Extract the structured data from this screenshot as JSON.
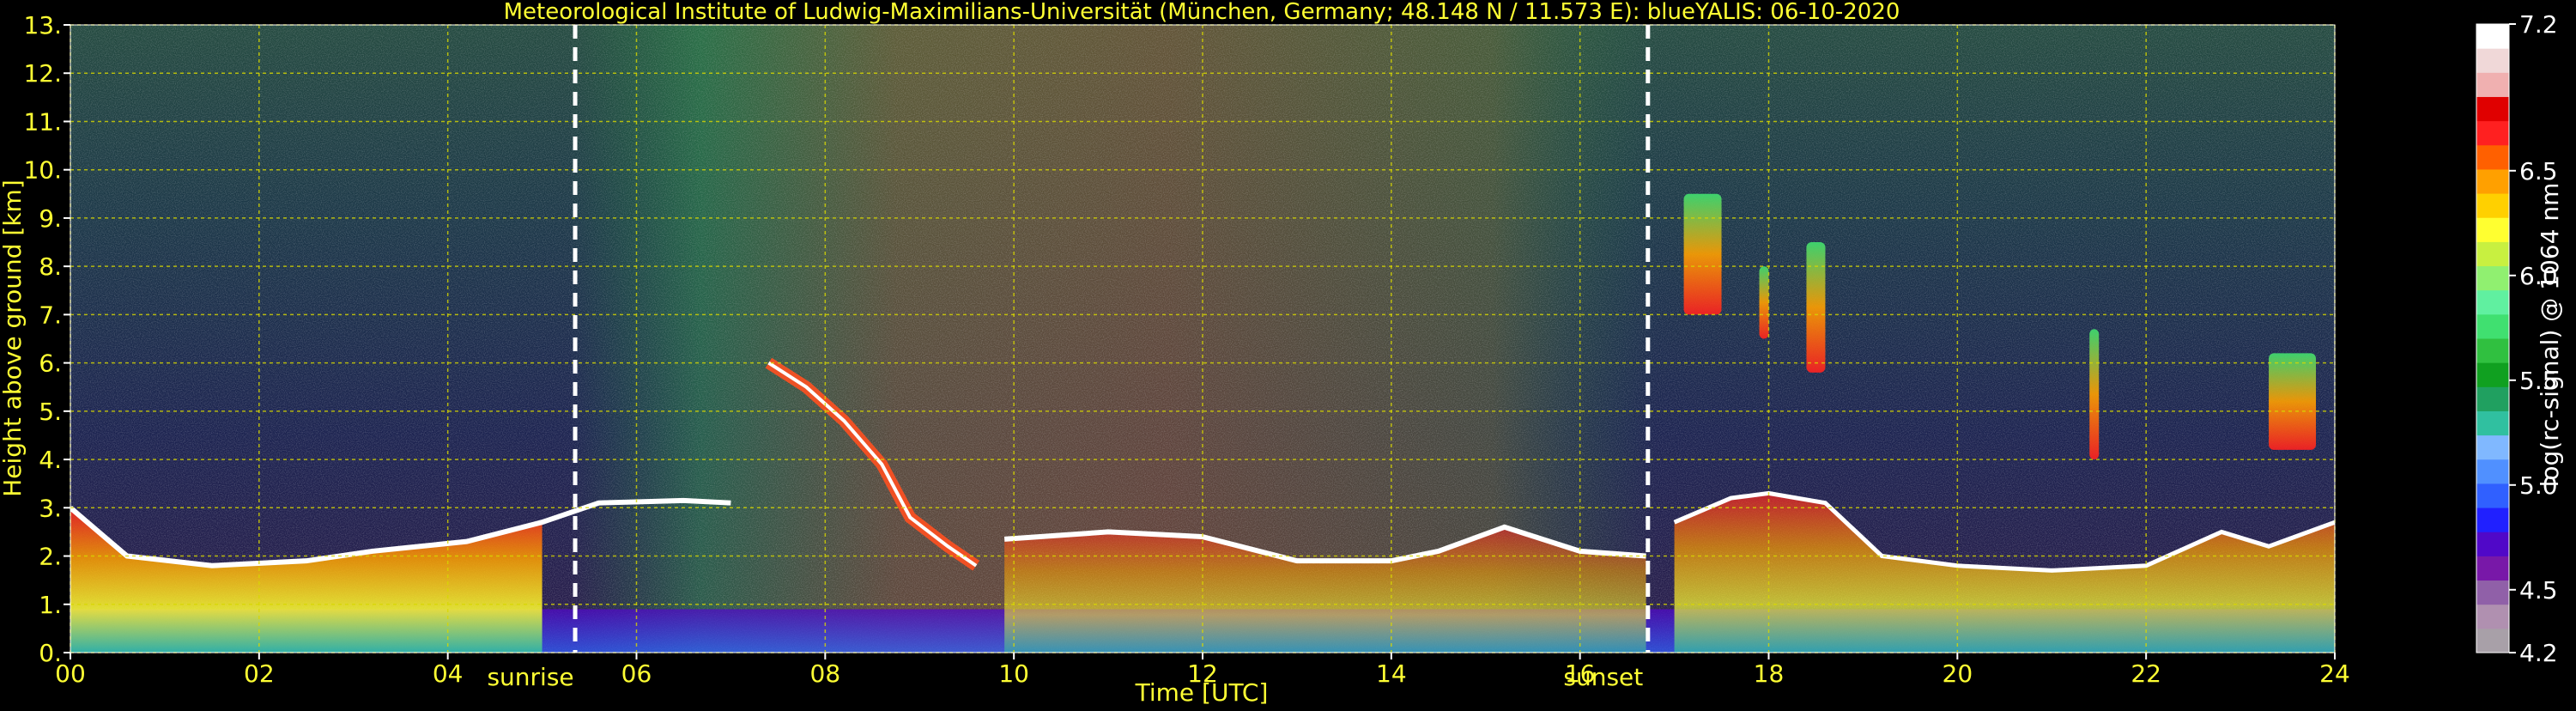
{
  "chart_data": {
    "type": "heatmap",
    "title": "Meteorological Institute of Ludwig-Maximilians-Universität (München, Germany; 48.148 N / 11.573 E):     blueYALIS: 06-10-2020",
    "xlabel": "Time [UTC]",
    "ylabel": "Height above ground [km]",
    "xlim": [
      0,
      24
    ],
    "ylim": [
      0,
      13
    ],
    "x_ticks": [
      "00",
      "02",
      "04",
      "06",
      "08",
      "10",
      "12",
      "14",
      "16",
      "18",
      "20",
      "22",
      "24"
    ],
    "y_ticks": [
      "0.",
      "1.",
      "2.",
      "3.",
      "4.",
      "5.",
      "6.",
      "7.",
      "8.",
      "9.",
      "10.",
      "11.",
      "12.",
      "13."
    ],
    "grid": true,
    "grid_color": "#d8d800",
    "text_color": "#ffff33",
    "events": [
      {
        "label": "sunrise",
        "time": 5.35
      },
      {
        "label": "sunset",
        "time": 16.72
      }
    ],
    "colorbar": {
      "label": "log(rc-signal) @ 1064 nm",
      "min": 4.2,
      "max": 7.2,
      "tick_labels": [
        "7.2",
        "6.5",
        "6.0",
        "5.5",
        "5.0",
        "4.5",
        "4.2"
      ],
      "tick_values": [
        7.2,
        6.5,
        6.0,
        5.5,
        5.0,
        4.5,
        4.2
      ],
      "colors": [
        "#a8a0a8",
        "#b090b0",
        "#9060a8",
        "#7818a8",
        "#5008c8",
        "#2020ff",
        "#3060ff",
        "#5090ff",
        "#80b8ff",
        "#30c0a0",
        "#20a060",
        "#10a020",
        "#30c040",
        "#40e070",
        "#60f0a0",
        "#90f070",
        "#c8f040",
        "#ffff30",
        "#ffd000",
        "#ffa000",
        "#ff6000",
        "#ff2020",
        "#e00000",
        "#f0b0b0",
        "#f0d8d8",
        "#ffffff"
      ]
    },
    "features": {
      "boundary_layer_top": [
        [
          0,
          3.0
        ],
        [
          0.6,
          2.0
        ],
        [
          1.5,
          1.8
        ],
        [
          2.5,
          1.9
        ],
        [
          3.2,
          2.1
        ],
        [
          4.2,
          2.3
        ],
        [
          5.0,
          2.7
        ],
        [
          5.6,
          3.1
        ],
        [
          6.5,
          3.15
        ],
        [
          7.0,
          3.1
        ]
      ],
      "descending_layer": [
        [
          7.4,
          6.0
        ],
        [
          7.8,
          5.5
        ],
        [
          8.2,
          4.8
        ],
        [
          8.6,
          3.9
        ],
        [
          8.9,
          2.8
        ],
        [
          9.3,
          2.2
        ],
        [
          9.6,
          1.8
        ]
      ],
      "afternoon_layer": [
        [
          9.9,
          2.35
        ],
        [
          11.0,
          2.5
        ],
        [
          12.0,
          2.4
        ],
        [
          13.0,
          1.9
        ],
        [
          14.0,
          1.9
        ],
        [
          14.5,
          2.1
        ],
        [
          15.2,
          2.6
        ],
        [
          16.0,
          2.1
        ],
        [
          16.7,
          2.0
        ]
      ],
      "upper_clouds": [
        {
          "time": [
            17.1,
            17.5
          ],
          "height": [
            7.0,
            9.5
          ]
        },
        {
          "time": [
            17.9,
            18.0
          ],
          "height": [
            6.5,
            8.0
          ]
        },
        {
          "time": [
            18.4,
            18.6
          ],
          "height": [
            5.8,
            8.5
          ]
        },
        {
          "time": [
            21.4,
            21.5
          ],
          "height": [
            4.0,
            6.7
          ]
        },
        {
          "time": [
            23.3,
            23.8
          ],
          "height": [
            4.2,
            6.2
          ]
        }
      ],
      "evening_layer": [
        [
          17.0,
          2.7
        ],
        [
          17.6,
          3.2
        ],
        [
          18.0,
          3.3
        ],
        [
          18.6,
          3.1
        ],
        [
          19.2,
          2.0
        ],
        [
          20.0,
          1.8
        ],
        [
          21.0,
          1.7
        ],
        [
          22.0,
          1.8
        ],
        [
          22.8,
          2.5
        ],
        [
          23.3,
          2.2
        ],
        [
          24.0,
          2.7
        ]
      ]
    }
  }
}
